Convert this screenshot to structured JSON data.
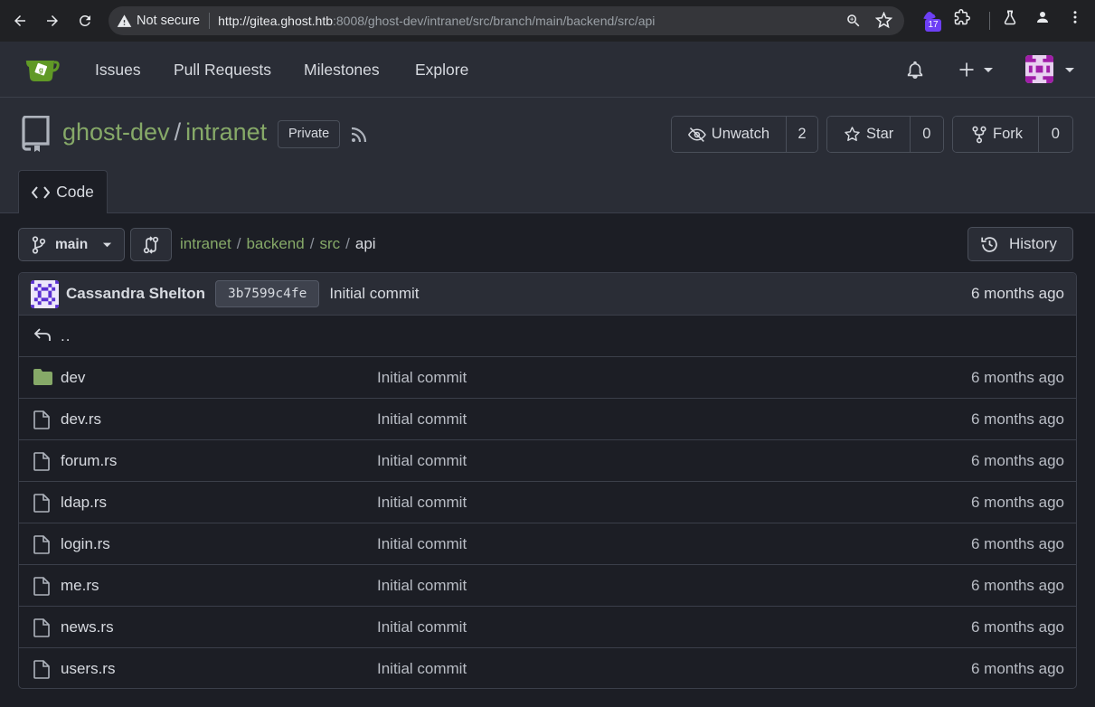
{
  "browser": {
    "security_label": "Not secure",
    "url_host": "http://gitea.ghost.htb",
    "url_rest": ":8008/ghost-dev/intranet/src/branch/main/backend/src/api",
    "extension_badge": "17"
  },
  "nav": {
    "links": [
      "Issues",
      "Pull Requests",
      "Milestones",
      "Explore"
    ]
  },
  "repo": {
    "owner": "ghost-dev",
    "separator": "/",
    "name": "intranet",
    "visibility": "Private",
    "unwatch_label": "Unwatch",
    "watch_count": "2",
    "star_label": "Star",
    "star_count": "0",
    "fork_label": "Fork",
    "fork_count": "0",
    "tab_code": "Code"
  },
  "branch": {
    "name": "main"
  },
  "breadcrumb": {
    "items": [
      "intranet",
      "backend",
      "src"
    ],
    "separator": "/",
    "current": "api"
  },
  "history_label": "History",
  "latest_commit": {
    "author": "Cassandra Shelton",
    "sha": "3b7599c4fe",
    "message": "Initial commit",
    "time": "6 months ago"
  },
  "parent_dir": "..",
  "files": [
    {
      "name": "dev",
      "type": "dir",
      "message": "Initial commit",
      "time": "6 months ago"
    },
    {
      "name": "dev.rs",
      "type": "file",
      "message": "Initial commit",
      "time": "6 months ago"
    },
    {
      "name": "forum.rs",
      "type": "file",
      "message": "Initial commit",
      "time": "6 months ago"
    },
    {
      "name": "ldap.rs",
      "type": "file",
      "message": "Initial commit",
      "time": "6 months ago"
    },
    {
      "name": "login.rs",
      "type": "file",
      "message": "Initial commit",
      "time": "6 months ago"
    },
    {
      "name": "me.rs",
      "type": "file",
      "message": "Initial commit",
      "time": "6 months ago"
    },
    {
      "name": "news.rs",
      "type": "file",
      "message": "Initial commit",
      "time": "6 months ago"
    },
    {
      "name": "users.rs",
      "type": "file",
      "message": "Initial commit",
      "time": "6 months ago"
    }
  ],
  "colors": {
    "accent_green": "#86a968",
    "page_bg": "#1c1e25",
    "panel_bg": "#2a2d36",
    "folder_icon": "#86a968"
  }
}
